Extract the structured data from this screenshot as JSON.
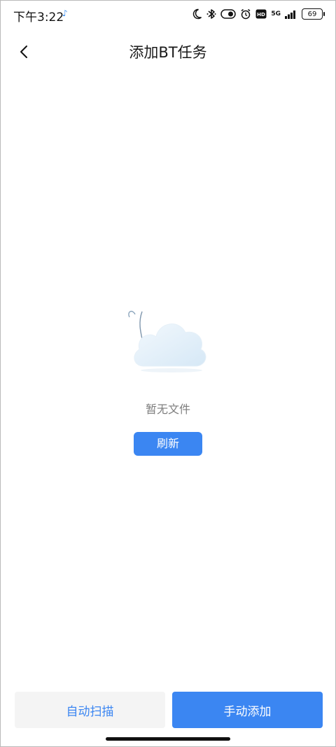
{
  "status_bar": {
    "time": "下午3:22",
    "network": "5G",
    "battery": "69",
    "icons": [
      "moon-icon",
      "bluetooth-icon",
      "toggle-icon",
      "alarm-icon",
      "hd-icon",
      "signal-icon",
      "battery-icon"
    ]
  },
  "header": {
    "title": "添加BT任务",
    "back_icon": "chevron-left-icon"
  },
  "empty_state": {
    "illustration": "cloud-icon",
    "message": "暂无文件",
    "refresh_label": "刷新"
  },
  "bottom_bar": {
    "auto_scan_label": "自动扫描",
    "manual_add_label": "手动添加"
  },
  "colors": {
    "accent": "#3b86f2",
    "secondary_button_bg": "#f4f4f4",
    "empty_text": "#7d7d7d"
  }
}
